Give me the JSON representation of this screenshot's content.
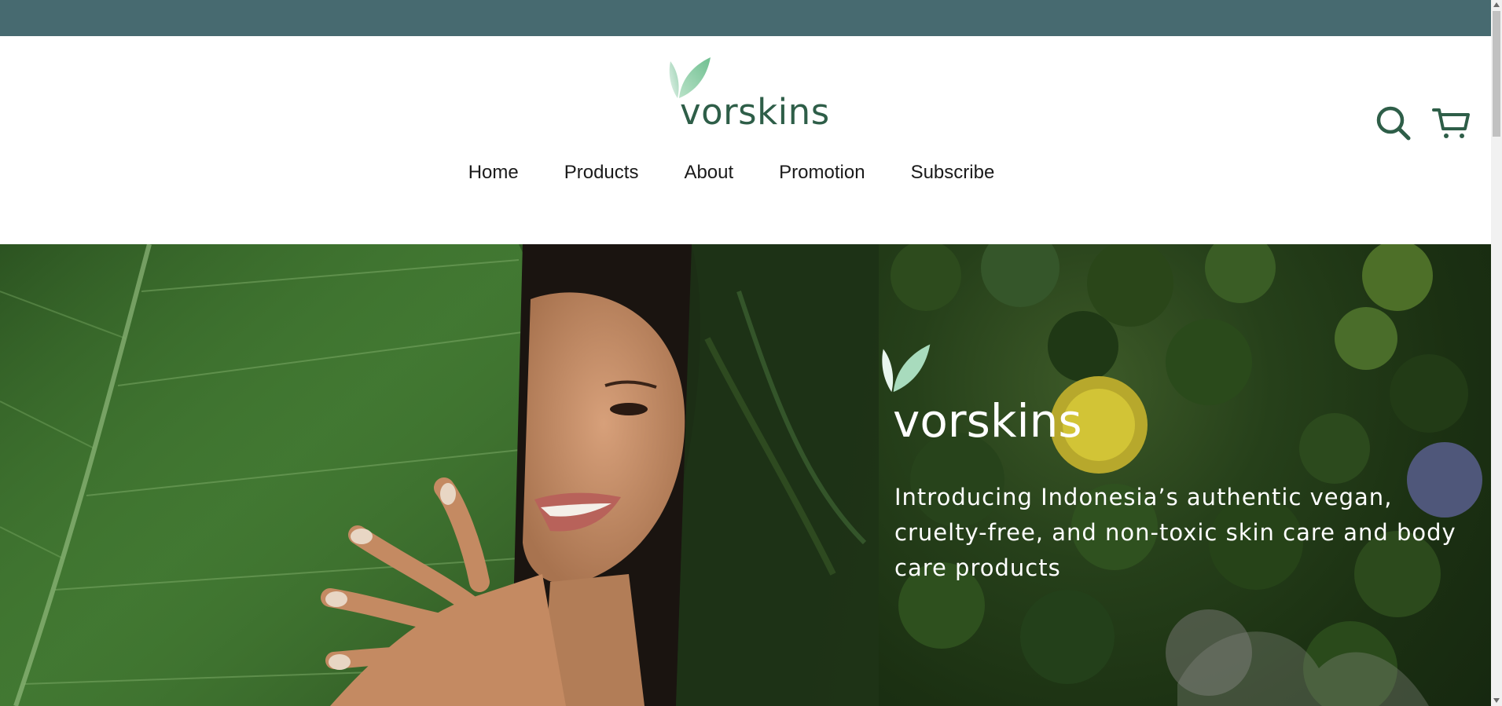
{
  "brand": {
    "name": "vorskins",
    "logo_icon": "leaf-icon",
    "brand_color": "#2e5e48"
  },
  "top_bar": {
    "color": "#476a70"
  },
  "nav": {
    "items": [
      {
        "label": "Home"
      },
      {
        "label": "Products"
      },
      {
        "label": "About"
      },
      {
        "label": "Promotion"
      },
      {
        "label": "Subscribe"
      }
    ]
  },
  "header_actions": {
    "search_icon": "search-icon",
    "cart_icon": "cart-icon"
  },
  "hero": {
    "brand_name": "vorskins",
    "tagline": "Introducing Indonesia’s authentic vegan, cruelty-free, and non-toxic skin care and body care products",
    "left_image": "woman-with-leaf-photo",
    "right_image": "forest-aerial-photo"
  }
}
